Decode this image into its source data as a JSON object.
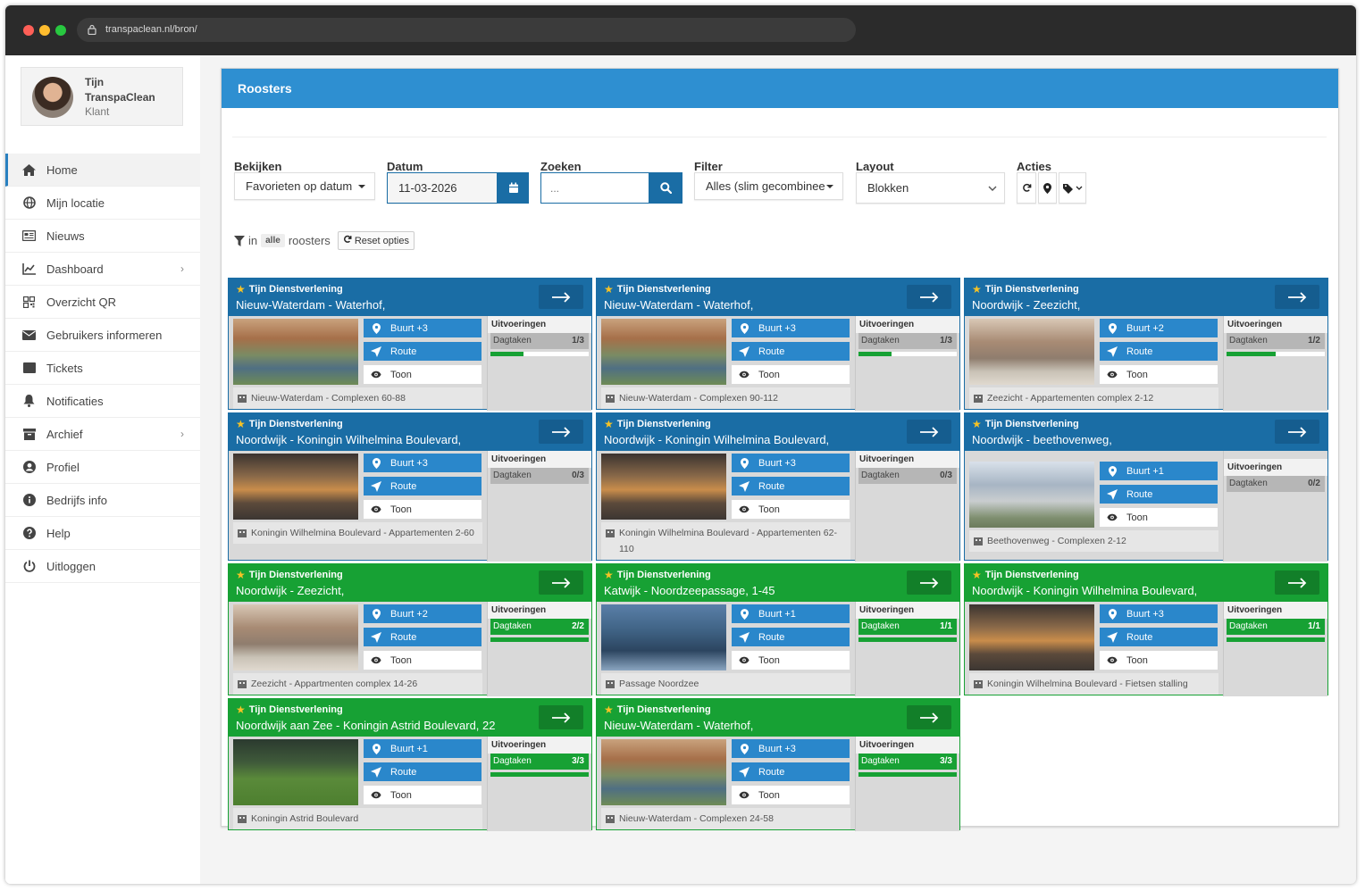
{
  "browser": {
    "url": "transpaclean.nl/bron/",
    "colors": {
      "close": "#fe5f57",
      "min": "#febc2e",
      "max": "#28c840"
    }
  },
  "user": {
    "first_name": "Tijn",
    "company": "TranspaClean",
    "role": "Klant"
  },
  "menu": [
    {
      "label": "Home",
      "icon": "home-icon",
      "active": true
    },
    {
      "label": "Mijn locatie",
      "icon": "globe-icon"
    },
    {
      "label": "Nieuws",
      "icon": "newspaper-icon"
    },
    {
      "label": "Dashboard",
      "icon": "chart-line-icon",
      "has_sub": true
    },
    {
      "label": "Overzicht QR",
      "icon": "qr-code-icon"
    },
    {
      "label": "Gebruikers informeren",
      "icon": "envelope-icon"
    },
    {
      "label": "Tickets",
      "icon": "ticket-icon"
    },
    {
      "label": "Notificaties",
      "icon": "bell-icon"
    },
    {
      "label": "Archief",
      "icon": "archive-icon",
      "has_sub": true
    },
    {
      "label": "Profiel",
      "icon": "user-circle-icon"
    },
    {
      "label": "Bedrijfs info",
      "icon": "info-icon"
    },
    {
      "label": "Help",
      "icon": "question-icon"
    },
    {
      "label": "Uitloggen",
      "icon": "power-icon"
    }
  ],
  "panel": {
    "title": "Roosters"
  },
  "controls": {
    "bekijken": {
      "label": "Bekijken",
      "value": "Favorieten op datum"
    },
    "datum": {
      "label": "Datum",
      "value": "11-03-2026"
    },
    "zoeken": {
      "label": "Zoeken",
      "placeholder": "..."
    },
    "filter": {
      "label": "Filter",
      "value": "Alles (slim gecombinee"
    },
    "layout": {
      "label": "Layout",
      "value": "Blokken"
    },
    "acties": {
      "label": "Acties"
    }
  },
  "filterline": {
    "in": "in",
    "scope": "alle",
    "suffix": "roosters",
    "reset": "Reset opties"
  },
  "card_labels": {
    "route": "Route",
    "toon": "Toon",
    "uitvoeringen": "Uitvoeringen",
    "dagtaken": "Dagtaken"
  },
  "cards": [
    {
      "company": "Tijn Dienstverlening",
      "location": "Nieuw-Waterdam - Waterhof,",
      "buurt": "Buurt +3",
      "done": 1,
      "total": 3,
      "count": "1/3",
      "address": "Nieuw-Waterdam - Complexen 60-88",
      "status": "blue",
      "img": "canal"
    },
    {
      "company": "Tijn Dienstverlening",
      "location": "Nieuw-Waterdam - Waterhof,",
      "buurt": "Buurt +3",
      "done": 1,
      "total": 3,
      "count": "1/3",
      "address": "Nieuw-Waterdam - Complexen 90-112",
      "status": "blue",
      "img": "canal"
    },
    {
      "company": "Tijn Dienstverlening",
      "location": "Noordwijk - Zeezicht,",
      "buurt": "Buurt +2",
      "done": 1,
      "total": 2,
      "count": "1/2",
      "address": "Zeezicht - Appartementen complex 2-12",
      "status": "blue",
      "img": "beach"
    },
    {
      "company": "Tijn Dienstverlening",
      "location": "Noordwijk - Koningin Wilhelmina Boulevard,",
      "buurt": "Buurt +3",
      "done": 0,
      "total": 3,
      "count": "0/3",
      "address": "Koningin Wilhelmina Boulevard - Appartementen 2-60",
      "status": "blue",
      "img": "boulevard"
    },
    {
      "company": "Tijn Dienstverlening",
      "location": "Noordwijk - Koningin Wilhelmina Boulevard,",
      "buurt": "Buurt +3",
      "done": 0,
      "total": 3,
      "count": "0/3",
      "address": "Koningin Wilhelmina Boulevard - Appartementen 62-110",
      "status": "blue",
      "img": "boulevard"
    },
    {
      "company": "Tijn Dienstverlening",
      "location": "Noordwijk - beethovenweg,",
      "buurt": "Buurt +1",
      "done": 0,
      "total": 2,
      "count": "0/2",
      "address": "Beethovenweg - Complexen 2-12",
      "status": "blue",
      "img": "modern"
    },
    {
      "company": "Tijn Dienstverlening",
      "location": "Noordwijk - Zeezicht,",
      "buurt": "Buurt +2",
      "done": 2,
      "total": 2,
      "count": "2/2",
      "address": "Zeezicht - Appartmenten complex 14-26",
      "status": "green",
      "img": "beach"
    },
    {
      "company": "Tijn Dienstverlening",
      "location": "Katwijk - Noordzeepassage, 1-45",
      "buurt": "Buurt +1",
      "done": 1,
      "total": 1,
      "count": "1/1",
      "address": "Passage Noordzee",
      "status": "green",
      "img": "glass"
    },
    {
      "company": "Tijn Dienstverlening",
      "location": "Noordwijk - Koningin Wilhelmina Boulevard,",
      "buurt": "Buurt +3",
      "done": 1,
      "total": 1,
      "count": "1/1",
      "address": "Koningin Wilhelmina Boulevard - Fietsen stalling",
      "status": "green",
      "img": "boulevard"
    },
    {
      "company": "Tijn Dienstverlening",
      "location": "Noordwijk aan Zee - Koningin Astrid Boulevard, 22",
      "buurt": "Buurt +1",
      "done": 3,
      "total": 3,
      "count": "3/3",
      "address": "Koningin Astrid Boulevard",
      "status": "green",
      "img": "lawn"
    },
    {
      "company": "Tijn Dienstverlening",
      "location": "Nieuw-Waterdam - Waterhof,",
      "buurt": "Buurt +3",
      "done": 3,
      "total": 3,
      "count": "3/3",
      "address": "Nieuw-Waterdam - Complexen 24-58",
      "status": "green",
      "img": "canal"
    }
  ]
}
